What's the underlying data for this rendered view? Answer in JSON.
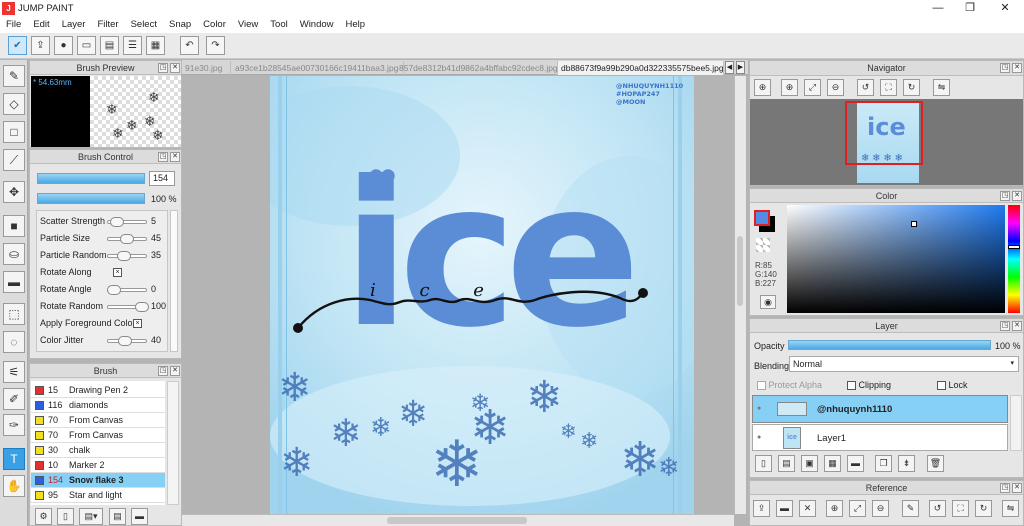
{
  "window": {
    "title": "JUMP PAINT",
    "logo": "J",
    "min": "—",
    "max": "❐",
    "close": "✕"
  },
  "menu": [
    "File",
    "Edit",
    "Layer",
    "Filter",
    "Select",
    "Snap",
    "Color",
    "View",
    "Tool",
    "Window",
    "Help"
  ],
  "toolbar_icons": [
    "brush-mode-icon",
    "export-icon",
    "comment-icon",
    "frame-icon",
    "page-icon",
    "list-icon",
    "grid-icon",
    "undo-icon",
    "redo-icon"
  ],
  "brush_preview": {
    "title": "Brush Preview",
    "size": "* 54.63mm"
  },
  "brush_control": {
    "title": "Brush Control",
    "size": "154",
    "opacity": "100 %",
    "params": [
      {
        "label": "Scatter Strength",
        "value": "5",
        "pos": 0.1
      },
      {
        "label": "Particle Size",
        "value": "45",
        "pos": 0.45
      },
      {
        "label": "Particle Random",
        "value": "35",
        "pos": 0.35
      },
      {
        "label": "Rotate Along",
        "value": "",
        "check": true
      },
      {
        "label": "Rotate Angle",
        "value": "0",
        "pos": 0.0
      },
      {
        "label": "Rotate Random",
        "value": "100",
        "pos": 1.0
      },
      {
        "label": "Apply Foreground Color",
        "value": "",
        "check": true
      },
      {
        "label": "Color Jitter",
        "value": "40",
        "pos": 0.4
      }
    ]
  },
  "brush_list": {
    "title": "Brush",
    "items": [
      {
        "size": "15",
        "name": "Drawing Pen 2",
        "color": "#e03030"
      },
      {
        "size": "116",
        "name": "diamonds",
        "color": "#2e5ee0"
      },
      {
        "size": "70",
        "name": "From Canvas",
        "color": "#f0e020"
      },
      {
        "size": "70",
        "name": "From Canvas",
        "color": "#f0e020"
      },
      {
        "size": "30",
        "name": "chalk",
        "color": "#f0e020"
      },
      {
        "size": "10",
        "name": "Marker 2",
        "color": "#e03030"
      },
      {
        "size": "154",
        "name": "Snow flake 3",
        "color": "#2e5ee0",
        "selected": true
      },
      {
        "size": "95",
        "name": "Star and light",
        "color": "#f0e020"
      }
    ]
  },
  "tabs": [
    "91e30.jpg",
    "a93ce1b28545ae00730166c19411baa3.jpg",
    "857de8312b41d9862a4bffabc92cdec8.jpg",
    "db88673f9a99b290a0d322335575bee5.jpg"
  ],
  "artwork": {
    "big_word": "ice",
    "script_word": "i c e",
    "credit": [
      "@NHUQUYNH1110",
      "#HOPAP247",
      "@MOON"
    ]
  },
  "navigator": {
    "title": "Navigator"
  },
  "color": {
    "title": "Color",
    "r": "R:85",
    "g": "G:140",
    "b": "B:227",
    "fg": "#558ce3"
  },
  "layer": {
    "title": "Layer",
    "opacity_label": "Opacity",
    "opacity": "100 %",
    "opacity_fill": 1.0,
    "blending_label": "Blending",
    "blending": "Normal",
    "protect_alpha": "Protect Alpha",
    "clipping": "Clipping",
    "lock": "Lock",
    "layers": [
      {
        "name": "@nhuquynh1110",
        "selected": true
      },
      {
        "name": "Layer1",
        "selected": false
      }
    ]
  },
  "reference": {
    "title": "Reference"
  }
}
